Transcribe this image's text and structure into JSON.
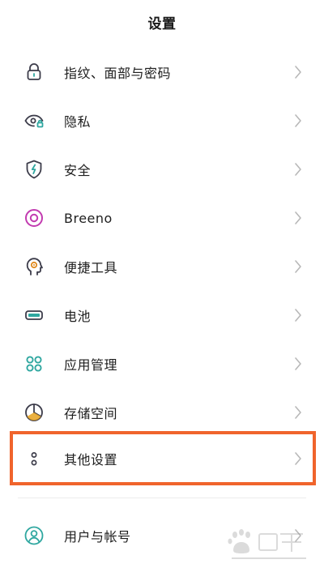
{
  "header": {
    "title": "设置"
  },
  "menu": {
    "items": [
      {
        "label": "指纹、面部与密码",
        "icon": "lock-icon"
      },
      {
        "label": "隐私",
        "icon": "eye-lock-icon"
      },
      {
        "label": "安全",
        "icon": "shield-bolt-icon"
      },
      {
        "label": "Breeno",
        "icon": "breeno-ring-icon"
      },
      {
        "label": "便捷工具",
        "icon": "head-gear-icon"
      },
      {
        "label": "电池",
        "icon": "battery-icon"
      },
      {
        "label": "应用管理",
        "icon": "apps-grid-icon"
      },
      {
        "label": "存储空间",
        "icon": "storage-pie-icon"
      },
      {
        "label": "其他设置",
        "icon": "more-dots-icon"
      },
      {
        "label": "用户与帐号",
        "icon": "user-account-icon"
      }
    ]
  },
  "colors": {
    "icon_stroke": "#3c3c4a",
    "icon_accent": "#2fa7a0",
    "breeno_ring": "#c23bb0",
    "highlight_border": "#f0642c",
    "chevron": "#b8b8b8"
  }
}
